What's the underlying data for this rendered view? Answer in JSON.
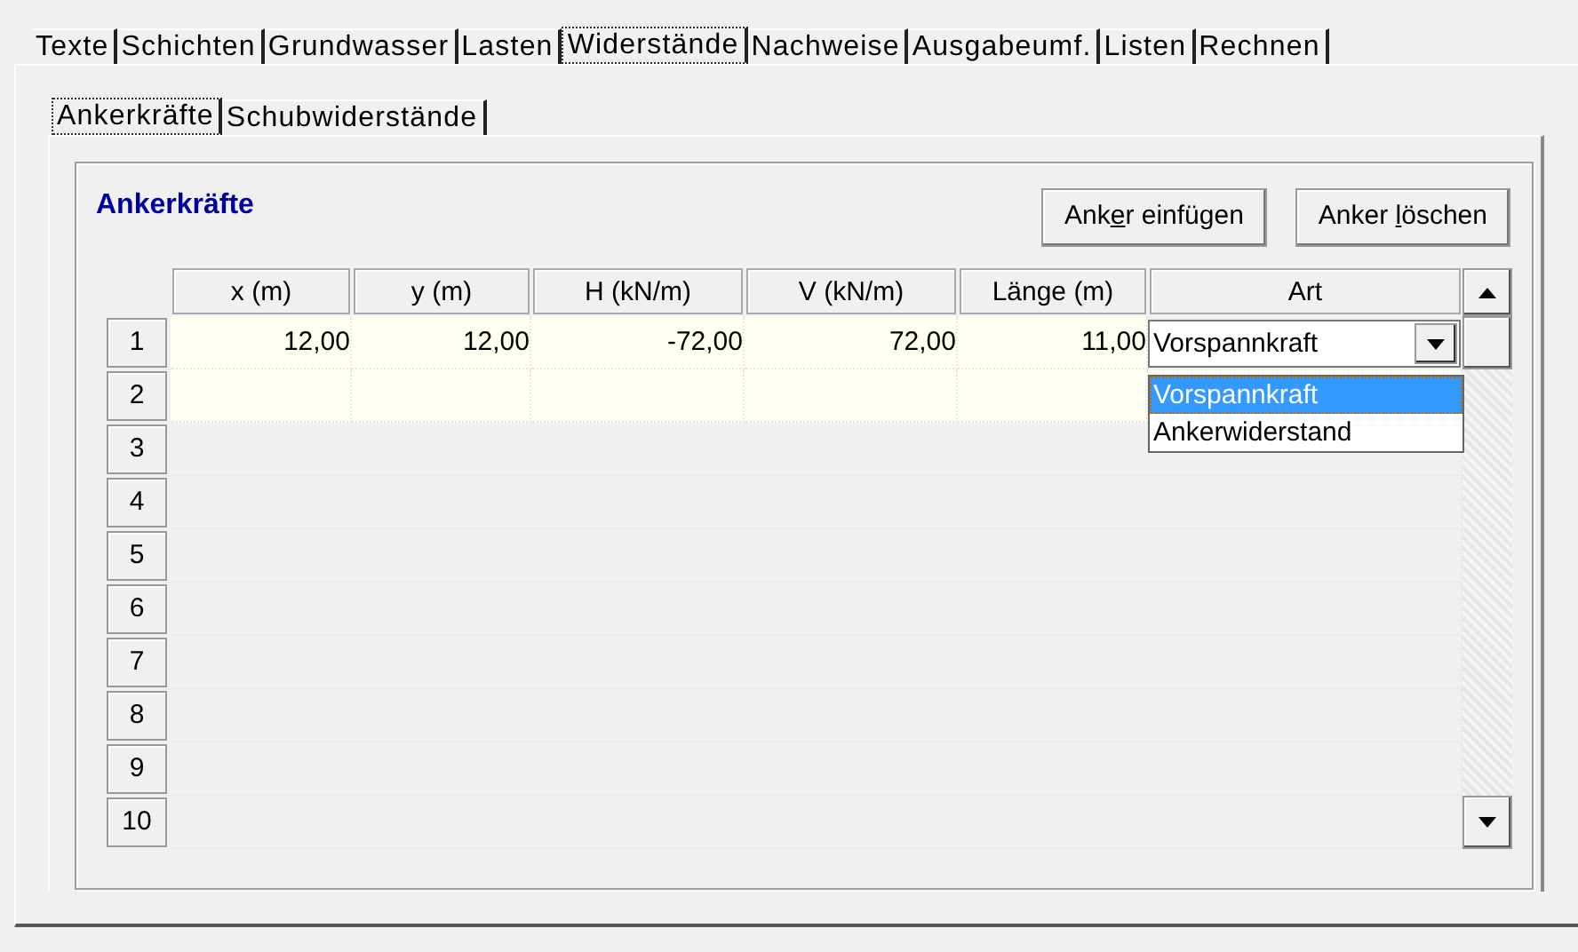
{
  "tabs": [
    {
      "label": "Texte",
      "selected": false
    },
    {
      "label": "Schichten",
      "selected": false
    },
    {
      "label": "Grundwasser",
      "selected": false
    },
    {
      "label": "Lasten",
      "selected": false
    },
    {
      "label": "Widerstände",
      "selected": true
    },
    {
      "label": "Nachweise",
      "selected": false
    },
    {
      "label": "Ausgabeumf.",
      "selected": false
    },
    {
      "label": "Listen",
      "selected": false
    },
    {
      "label": "Rechnen",
      "selected": false
    }
  ],
  "subtabs": [
    {
      "label": "Ankerkräfte",
      "selected": true
    },
    {
      "label": "Schubwiderstände",
      "selected": false
    }
  ],
  "group": {
    "title": "Ankerkräfte",
    "buttons": [
      {
        "before": "Ank",
        "mnemonic": "e",
        "after": "r einfügen"
      },
      {
        "before": "Anker ",
        "mnemonic": "l",
        "after": "öschen"
      }
    ],
    "table": {
      "columns": [
        "x (m)",
        "y (m)",
        "H (kN/m)",
        "V (kN/m)",
        "Länge (m)",
        "Art"
      ],
      "rows": [
        {
          "number": "1",
          "editable": true,
          "cells": [
            "12,00",
            "12,00",
            "-72,00",
            "72,00",
            "11,00"
          ],
          "art": {
            "value": "Vorspannkraft",
            "expanded": true,
            "options": [
              {
                "label": "Vorspannkraft",
                "selected": true
              },
              {
                "label": "Ankerwiderstand",
                "selected": false
              }
            ]
          }
        },
        {
          "number": "2",
          "editable": true,
          "cells": [
            "",
            "",
            "",
            "",
            ""
          ]
        },
        {
          "number": "3",
          "editable": false
        },
        {
          "number": "4",
          "editable": false
        },
        {
          "number": "5",
          "editable": false
        },
        {
          "number": "6",
          "editable": false
        },
        {
          "number": "7",
          "editable": false
        },
        {
          "number": "8",
          "editable": false
        },
        {
          "number": "9",
          "editable": false
        },
        {
          "number": "10",
          "editable": false
        }
      ]
    }
  }
}
